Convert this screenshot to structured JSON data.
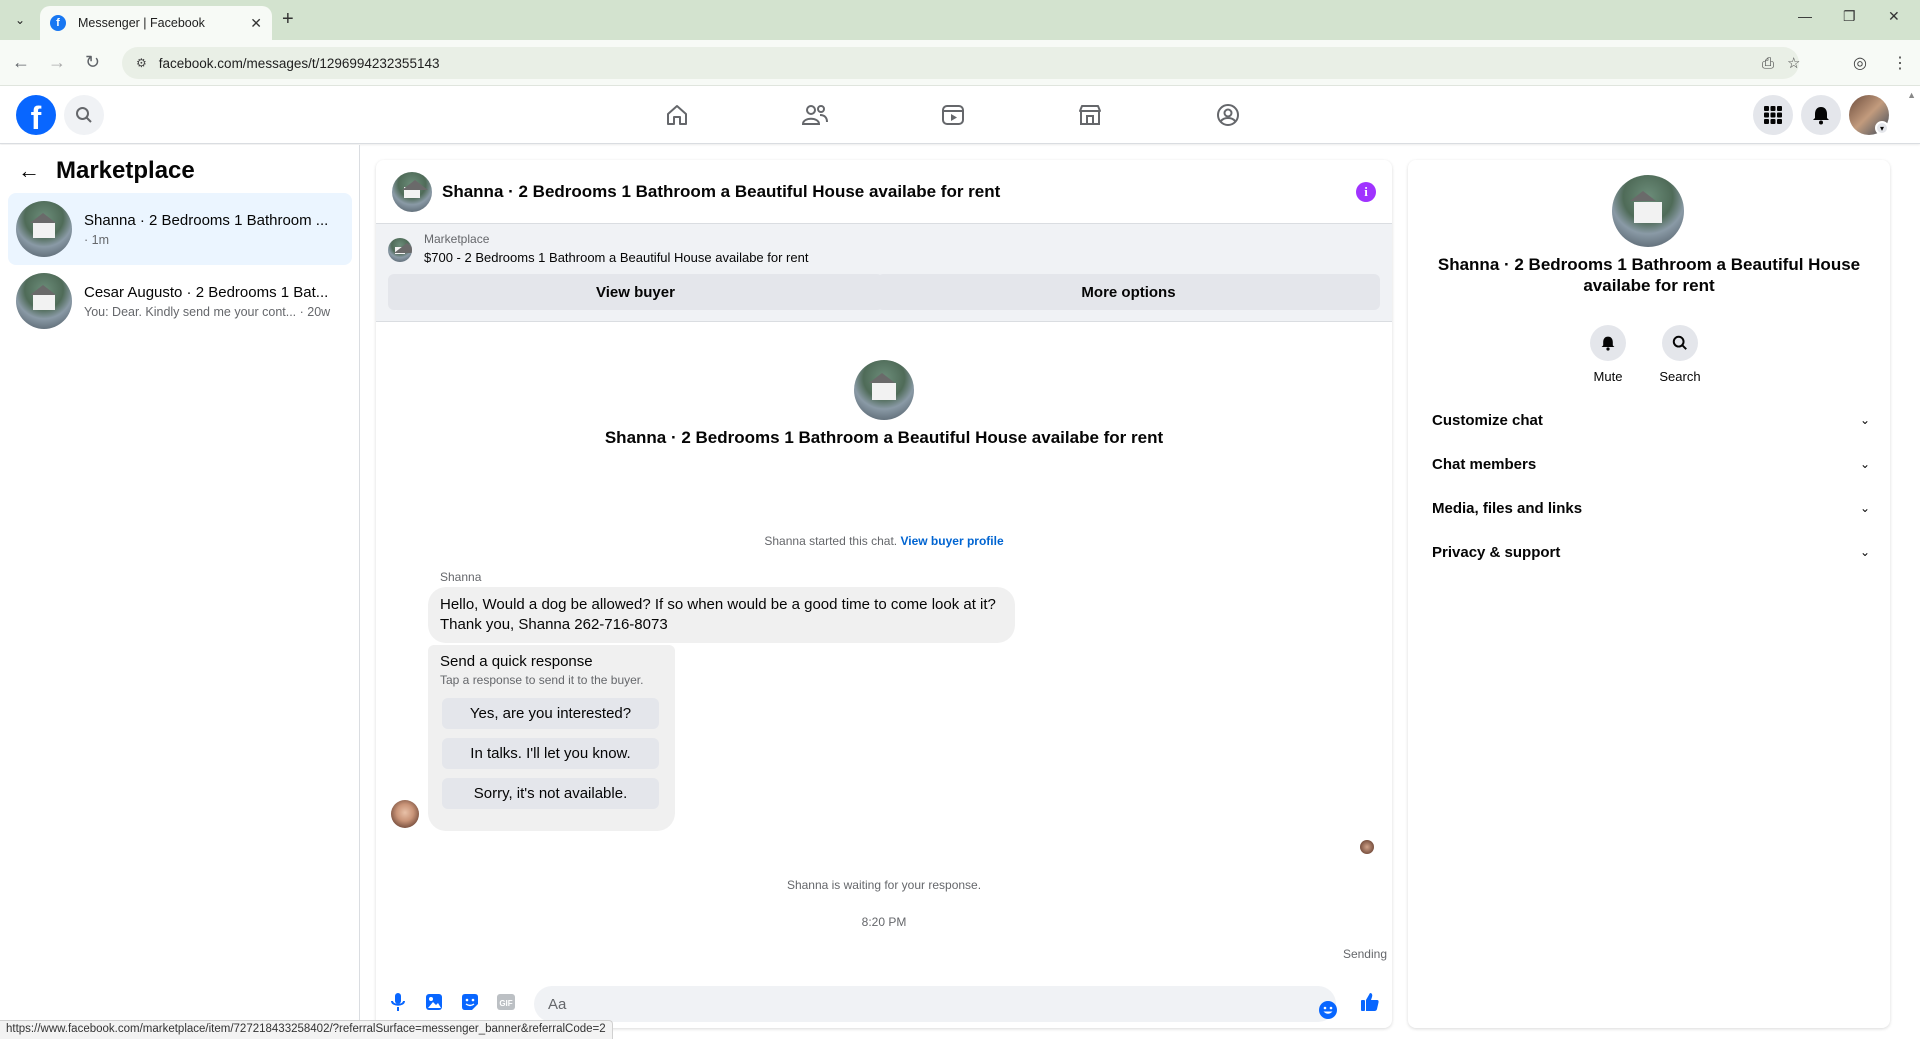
{
  "browser": {
    "tab_title": "Messenger | Facebook",
    "url": "facebook.com/messages/t/1296994232355143",
    "status_url": "https://www.facebook.com/marketplace/item/727218433258402/?referralSurface=messenger_banner&referralCode=2"
  },
  "sidebar": {
    "title": "Marketplace",
    "conversations": [
      {
        "name": "Shanna · 2 Bedrooms 1 Bathroom ...",
        "sub": "· 1m"
      },
      {
        "name": "Cesar Augusto · 2 Bedrooms 1 Bat...",
        "sub": "You: Dear. Kindly send me your cont... · 20w"
      }
    ]
  },
  "chat": {
    "title": "Shanna · 2 Bedrooms 1 Bathroom a Beautiful House availabe for rent",
    "banner": {
      "label": "Marketplace",
      "description": "$700 - 2 Bedrooms 1 Bathroom a Beautiful House availabe for rent",
      "view_buyer": "View buyer",
      "more_options": "More options"
    },
    "center_title": "Shanna · 2 Bedrooms 1 Bathroom a Beautiful House availabe for rent",
    "started_text": "Shanna started this chat.",
    "view_buyer_profile": "View buyer profile",
    "sender": "Shanna",
    "message": "Hello, Would a dog be allowed? If so when would be a good time to come look at it? Thank you, Shanna 262-716-8073",
    "quick_response": {
      "title": "Send a quick response",
      "subtitle": "Tap a response to send it to the buyer.",
      "options": [
        "Yes, are you interested?",
        "In talks. I'll let you know.",
        "Sorry, it's not available."
      ]
    },
    "waiting": "Shanna is waiting for your response.",
    "timestamp": "8:20 PM",
    "sending": "Sending",
    "composer_placeholder": "Aa"
  },
  "details": {
    "title": "Shanna · 2 Bedrooms 1 Bathroom a Beautiful House availabe for rent",
    "mute": "Mute",
    "search": "Search",
    "sections": [
      "Customize chat",
      "Chat members",
      "Media, files and links",
      "Privacy & support"
    ]
  },
  "colors": {
    "brand": "#0866ff",
    "info": "#a033ff",
    "link": "#0064d1"
  }
}
